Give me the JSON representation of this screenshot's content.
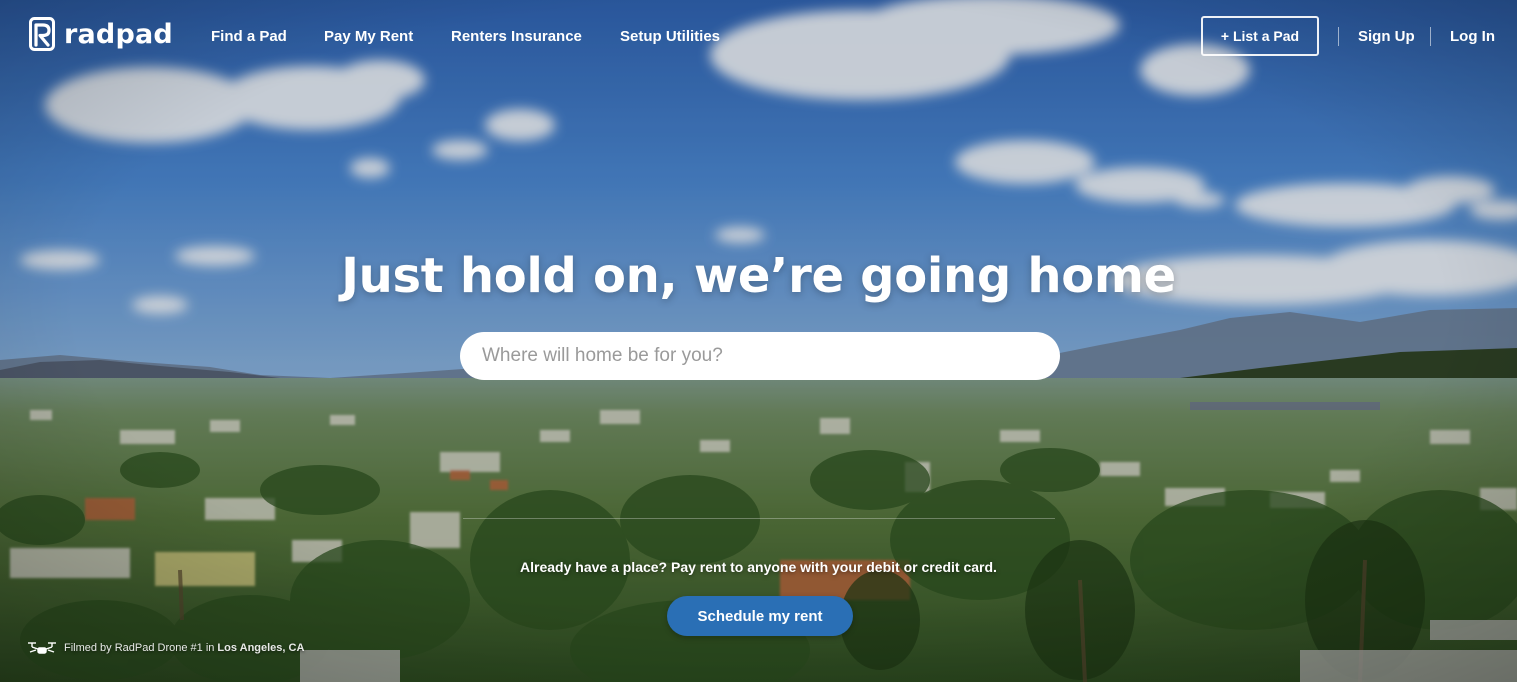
{
  "brand": {
    "name": "radpad"
  },
  "nav": {
    "items": [
      {
        "label": "Find a Pad"
      },
      {
        "label": "Pay My Rent"
      },
      {
        "label": "Renters Insurance"
      },
      {
        "label": "Setup Utilities"
      }
    ],
    "list_pad_label": "+ List a Pad",
    "sign_up_label": "Sign Up",
    "log_in_label": "Log In"
  },
  "hero": {
    "title": "Just hold on, we’re going home",
    "search_placeholder": "Where will home be for you?",
    "search_value": "",
    "pay_text": "Already have a place? Pay rent to anyone with your debit or credit card.",
    "schedule_label": "Schedule my rent"
  },
  "credit": {
    "text": "Filmed by RadPad Drone #1 in",
    "location": "Los Angeles, CA"
  },
  "colors": {
    "sky": "#3f78c4",
    "button_blue": "#2a6fb5",
    "foliage": "#3d6a2c"
  },
  "icons": {
    "logo": "radpad-r-logo",
    "credit": "drone-icon"
  }
}
